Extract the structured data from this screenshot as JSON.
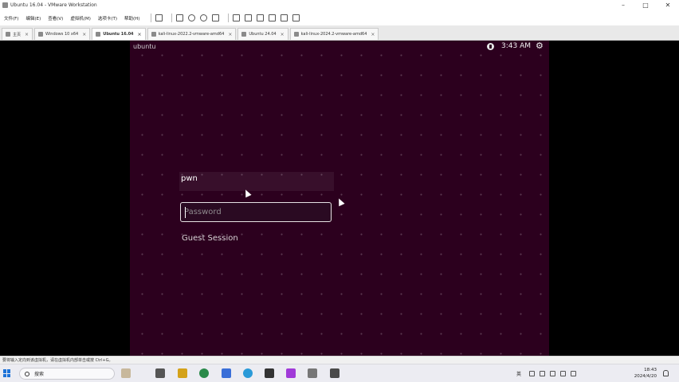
{
  "window": {
    "title": "Ubuntu 16.04 - VMware Workstation",
    "minimize_icon": "minimize-icon",
    "maximize_icon": "maximize-icon",
    "close_icon": "close-icon"
  },
  "menu": {
    "items": [
      "文件(F)",
      "编辑(E)",
      "查看(V)",
      "虚拟机(M)",
      "选项卡(T)",
      "帮助(H)"
    ]
  },
  "tabs": [
    {
      "label": "主页",
      "active": false
    },
    {
      "label": "Windows 10 x64",
      "active": false
    },
    {
      "label": "Ubuntu 16.04",
      "active": true
    },
    {
      "label": "kali-linux-2022.2-vmware-amd64",
      "active": false
    },
    {
      "label": "Ubuntu 24.04",
      "active": false
    },
    {
      "label": "kali-linux-2024.2-vmware-amd64",
      "active": false
    }
  ],
  "vm": {
    "distro_label": "ubuntu",
    "clock": "3:43 AM",
    "username": "pwn",
    "password_placeholder": "Password",
    "guest_session": "Guest Session",
    "background_color": "#2c001e"
  },
  "statusbar": {
    "text": "要将输入定向到该虚拟机，请在虚拟机内部单击或按 Ctrl+G。"
  },
  "taskbar": {
    "search_label": "搜索",
    "ime": "英",
    "time": "18:43",
    "date": "2024/4/20"
  }
}
